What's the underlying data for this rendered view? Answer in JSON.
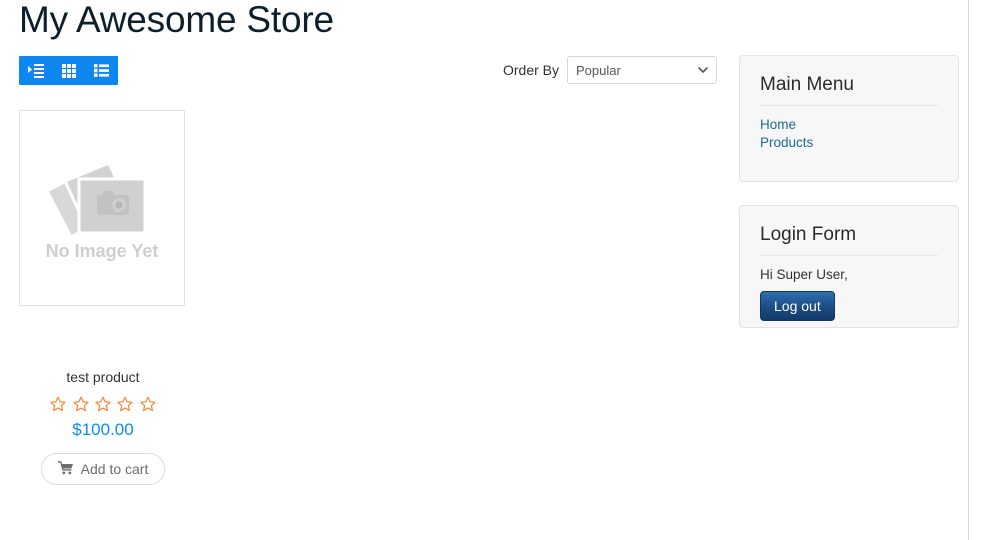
{
  "page": {
    "title": "My Awesome Store"
  },
  "view_toggle": {
    "buttons": [
      {
        "name": "indent-icon",
        "label": "Detail view",
        "icon": "indent-icon"
      },
      {
        "name": "grid-icon",
        "label": "Grid view",
        "icon": "grid-icon"
      },
      {
        "name": "list-icon",
        "label": "List view",
        "icon": "list-icon"
      }
    ],
    "background_color": "#0f87f0"
  },
  "order_by": {
    "label": "Order By",
    "selected": "Popular",
    "options": [
      "Popular"
    ]
  },
  "products": [
    {
      "name": "test product",
      "price": "$100.00",
      "rating": 0,
      "max_rating": 5,
      "image_placeholder_text": "No Image Yet",
      "add_to_cart_label": "Add to cart"
    }
  ],
  "sidebar": {
    "modules": [
      {
        "title": "Main Menu",
        "type": "menu",
        "items": [
          {
            "label": "Home"
          },
          {
            "label": "Products"
          }
        ]
      },
      {
        "title": "Login Form",
        "type": "login",
        "greeting": "Hi Super User,",
        "logout_label": "Log out"
      }
    ]
  },
  "colors": {
    "accent_blue": "#0f87f0",
    "price_blue": "#0d8bf2",
    "link_blue": "#216a94",
    "star_orange": "#f0893c",
    "title_dark": "#0d1f2b",
    "button_blue_dark": "#123a6b"
  }
}
